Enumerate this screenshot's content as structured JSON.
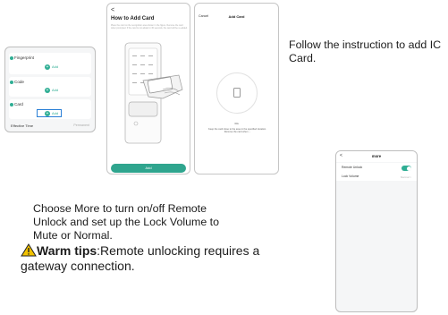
{
  "methods_screen": {
    "rows": [
      {
        "title": "Fingerprint",
        "add_label": "Add"
      },
      {
        "title": "Code",
        "add_label": "Add"
      },
      {
        "title": "Card",
        "add_label": "Add"
      }
    ],
    "effective_time": {
      "label": "Effective Time",
      "value": "Permanent"
    }
  },
  "how_to_screen": {
    "back": "<",
    "title": "How to Add Card",
    "description": "Place the card on the recognition area shown in the figure. Remove the card when prompted. If the card is not added in 30 seconds, the card will be re-added.",
    "add_button": "Add"
  },
  "add_card_screen": {
    "cancel": "Cancel",
    "title": "Add Card",
    "countdown": "30s",
    "tip": "Keep the card close to the area in the specified duration. Remove the card when ..."
  },
  "more_screen": {
    "back": "<",
    "title": "more",
    "remote_unlock_label": "Remote Unlock",
    "remote_unlock_on": true,
    "lock_volume_label": "Lock Volume",
    "lock_volume_value": "Normal >"
  },
  "instructions": {
    "add_card": "Follow the instruction to add IC Card.",
    "more": "Choose More to turn on/off Remote Unlock and set up the Lock Volume to Mute or Normal.",
    "warm_title": "Warm tips",
    "warm_text": ":Remote unlocking requires a gateway connection."
  },
  "colors": {
    "accent": "#2fae94",
    "highlight": "#2a7fd6",
    "warning": "#f2c200"
  },
  "icons": [
    "warning-icon",
    "card-icon",
    "back-icon",
    "hand-icon"
  ]
}
